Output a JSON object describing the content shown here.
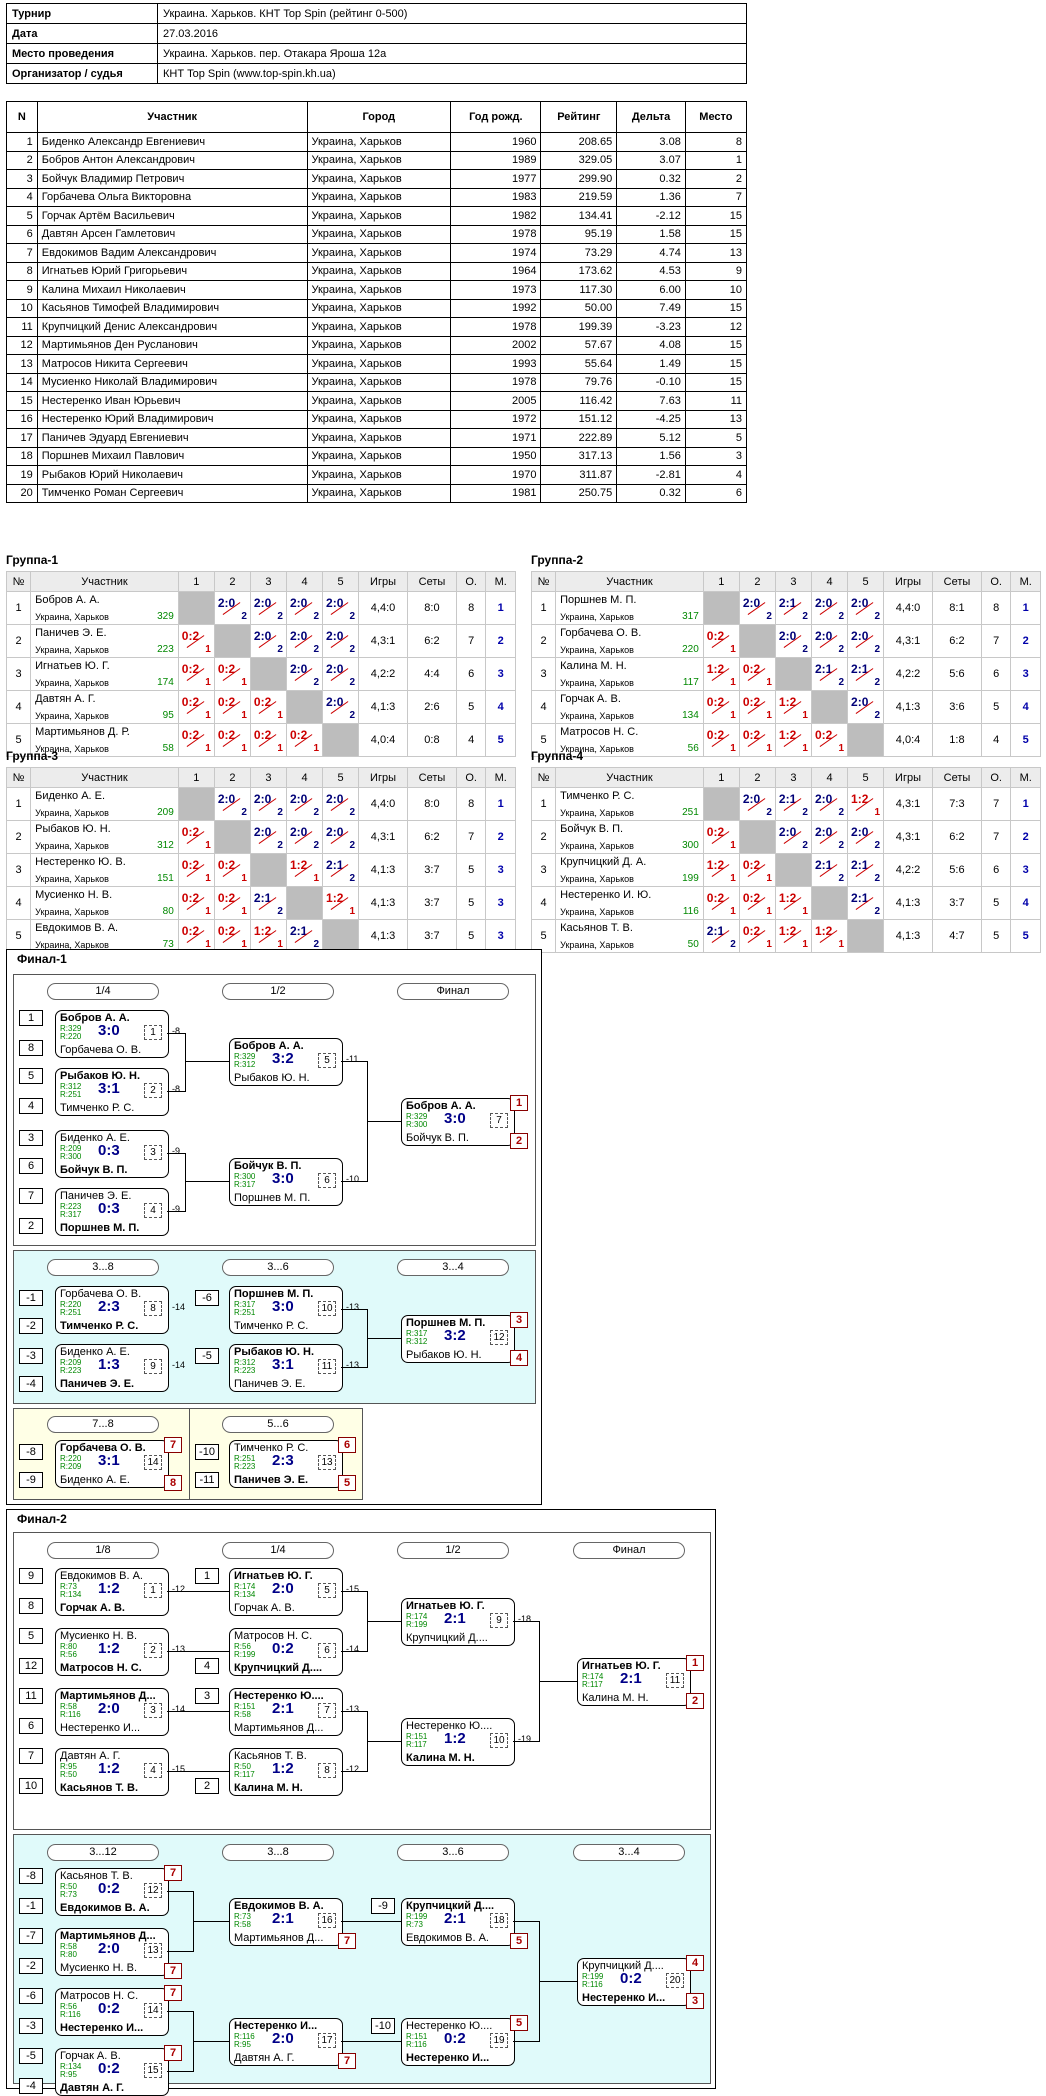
{
  "info": {
    "rows": [
      [
        "Турнир",
        "Украина. Харьков. КНТ Top Spin (рейтинг 0-500)"
      ],
      [
        "Дата",
        "27.03.2016"
      ],
      [
        "Место проведения",
        "Украина. Харьков. пер. Отакара Яроша 12а"
      ],
      [
        "Организатор / судья",
        "КНТ Top Spin (www.top-spin.kh.ua)"
      ]
    ]
  },
  "participants": {
    "headers": [
      "N",
      "Участник",
      "Город",
      "Год рожд.",
      "Рейтинг",
      "Дельта",
      "Место"
    ],
    "rows": [
      [
        "1",
        "Биденко Александр Евгениевич",
        "Украина, Харьков",
        "1960",
        "208.65",
        "3.08",
        "8"
      ],
      [
        "2",
        "Бобров Антон Александрович",
        "Украина, Харьков",
        "1989",
        "329.05",
        "3.07",
        "1"
      ],
      [
        "3",
        "Бойчук Владимир Петрович",
        "Украина, Харьков",
        "1977",
        "299.90",
        "0.32",
        "2"
      ],
      [
        "4",
        "Горбачева Ольга Викторовна",
        "Украина, Харьков",
        "1983",
        "219.59",
        "1.36",
        "7"
      ],
      [
        "5",
        "Горчак Артём Васильевич",
        "Украина, Харьков",
        "1982",
        "134.41",
        "-2.12",
        "15"
      ],
      [
        "6",
        "Давтян Арсен Гамлетович",
        "Украина, Харьков",
        "1978",
        "95.19",
        "1.58",
        "15"
      ],
      [
        "7",
        "Евдокимов Вадим Александрович",
        "Украина, Харьков",
        "1974",
        "73.29",
        "4.74",
        "13"
      ],
      [
        "8",
        "Игнатьев Юрий Григорьевич",
        "Украина, Харьков",
        "1964",
        "173.62",
        "4.53",
        "9"
      ],
      [
        "9",
        "Калина Михаил Николаевич",
        "Украина, Харьков",
        "1973",
        "117.30",
        "6.00",
        "10"
      ],
      [
        "10",
        "Касьянов Тимофей Владимирович",
        "Украина, Харьков",
        "1992",
        "50.00",
        "7.49",
        "15"
      ],
      [
        "11",
        "Крупчицкий Денис Александрович",
        "Украина, Харьков",
        "1978",
        "199.39",
        "-3.23",
        "12"
      ],
      [
        "12",
        "Мартимьянов Ден Русланович",
        "Украина, Харьков",
        "2002",
        "57.67",
        "4.08",
        "15"
      ],
      [
        "13",
        "Матросов Никита Сергеевич",
        "Украина, Харьков",
        "1993",
        "55.64",
        "1.49",
        "15"
      ],
      [
        "14",
        "Мусиенко Николай Владимирович",
        "Украина, Харьков",
        "1978",
        "79.76",
        "-0.10",
        "15"
      ],
      [
        "15",
        "Нестеренко Иван Юрьевич",
        "Украина, Харьков",
        "2005",
        "116.42",
        "7.63",
        "11"
      ],
      [
        "16",
        "Нестеренко Юрий Владимирович",
        "Украина, Харьков",
        "1972",
        "151.12",
        "-4.25",
        "13"
      ],
      [
        "17",
        "Паничев Эдуард Евгениевич",
        "Украина, Харьков",
        "1971",
        "222.89",
        "5.12",
        "5"
      ],
      [
        "18",
        "Поршнев Михаил Павлович",
        "Украина, Харьков",
        "1950",
        "317.13",
        "1.56",
        "3"
      ],
      [
        "19",
        "Рыбаков Юрий Николаевич",
        "Украина, Харьков",
        "1970",
        "311.87",
        "-2.81",
        "4"
      ],
      [
        "20",
        "Тимченко Роман Сергеевич",
        "Украина, Харьков",
        "1981",
        "250.75",
        "0.32",
        "6"
      ]
    ]
  },
  "group_headers": [
    "№",
    "Участник",
    "1",
    "2",
    "3",
    "4",
    "5",
    "Игры",
    "Сеты",
    "О.",
    "М."
  ],
  "groups": [
    {
      "title": "Группа-1",
      "rows": [
        {
          "n": "1",
          "name": "Бобров А. А.",
          "city": "Украина, Харьков",
          "rating": "329",
          "scores": [
            "",
            "2:0",
            "2:0",
            "2:0",
            "2:0"
          ],
          "games": "4,4:0",
          "sets": "8:0",
          "pts": "8",
          "place": "1"
        },
        {
          "n": "2",
          "name": "Паничев Э. Е.",
          "city": "Украина, Харьков",
          "rating": "223",
          "scores": [
            "0:2",
            "",
            "2:0",
            "2:0",
            "2:0"
          ],
          "games": "4,3:1",
          "sets": "6:2",
          "pts": "7",
          "place": "2"
        },
        {
          "n": "3",
          "name": "Игнатьев Ю. Г.",
          "city": "Украина, Харьков",
          "rating": "174",
          "scores": [
            "0:2",
            "0:2",
            "",
            "2:0",
            "2:0"
          ],
          "games": "4,2:2",
          "sets": "4:4",
          "pts": "6",
          "place": "3"
        },
        {
          "n": "4",
          "name": "Давтян А. Г.",
          "city": "Украина, Харьков",
          "rating": "95",
          "scores": [
            "0:2",
            "0:2",
            "0:2",
            "",
            "2:0"
          ],
          "games": "4,1:3",
          "sets": "2:6",
          "pts": "5",
          "place": "4"
        },
        {
          "n": "5",
          "name": "Мартимьянов Д. Р.",
          "city": "Украина, Харьков",
          "rating": "58",
          "scores": [
            "0:2",
            "0:2",
            "0:2",
            "0:2",
            ""
          ],
          "games": "4,0:4",
          "sets": "0:8",
          "pts": "4",
          "place": "5"
        }
      ]
    },
    {
      "title": "Группа-2",
      "rows": [
        {
          "n": "1",
          "name": "Поршнев М. П.",
          "city": "Украина, Харьков",
          "rating": "317",
          "scores": [
            "",
            "2:0",
            "2:1",
            "2:0",
            "2:0"
          ],
          "games": "4,4:0",
          "sets": "8:1",
          "pts": "8",
          "place": "1"
        },
        {
          "n": "2",
          "name": "Горбачева О. В.",
          "city": "Украина, Харьков",
          "rating": "220",
          "scores": [
            "0:2",
            "",
            "2:0",
            "2:0",
            "2:0"
          ],
          "games": "4,3:1",
          "sets": "6:2",
          "pts": "7",
          "place": "2"
        },
        {
          "n": "3",
          "name": "Калина М. Н.",
          "city": "Украина, Харьков",
          "rating": "117",
          "scores": [
            "1:2",
            "0:2",
            "",
            "2:1",
            "2:1"
          ],
          "games": "4,2:2",
          "sets": "5:6",
          "pts": "6",
          "place": "3"
        },
        {
          "n": "4",
          "name": "Горчак А. В.",
          "city": "Украина, Харьков",
          "rating": "134",
          "scores": [
            "0:2",
            "0:2",
            "1:2",
            "",
            "2:0"
          ],
          "games": "4,1:3",
          "sets": "3:6",
          "pts": "5",
          "place": "4"
        },
        {
          "n": "5",
          "name": "Матросов Н. С.",
          "city": "Украина, Харьков",
          "rating": "56",
          "scores": [
            "0:2",
            "0:2",
            "1:2",
            "0:2",
            ""
          ],
          "games": "4,0:4",
          "sets": "1:8",
          "pts": "4",
          "place": "5"
        }
      ]
    },
    {
      "title": "Группа-3",
      "rows": [
        {
          "n": "1",
          "name": "Биденко А. Е.",
          "city": "Украина, Харьков",
          "rating": "209",
          "scores": [
            "",
            "2:0",
            "2:0",
            "2:0",
            "2:0"
          ],
          "games": "4,4:0",
          "sets": "8:0",
          "pts": "8",
          "place": "1"
        },
        {
          "n": "2",
          "name": "Рыбаков Ю. Н.",
          "city": "Украина, Харьков",
          "rating": "312",
          "scores": [
            "0:2",
            "",
            "2:0",
            "2:0",
            "2:0"
          ],
          "games": "4,3:1",
          "sets": "6:2",
          "pts": "7",
          "place": "2"
        },
        {
          "n": "3",
          "name": "Нестеренко Ю. В.",
          "city": "Украина, Харьков",
          "rating": "151",
          "scores": [
            "0:2",
            "0:2",
            "",
            "1:2",
            "2:1"
          ],
          "games": "4,1:3",
          "sets": "3:7",
          "pts": "5",
          "place": "3"
        },
        {
          "n": "4",
          "name": "Мусиенко Н. В.",
          "city": "Украина, Харьков",
          "rating": "80",
          "scores": [
            "0:2",
            "0:2",
            "2:1",
            "",
            "1:2"
          ],
          "games": "4,1:3",
          "sets": "3:7",
          "pts": "5",
          "place": "3"
        },
        {
          "n": "5",
          "name": "Евдокимов В. А.",
          "city": "Украина, Харьков",
          "rating": "73",
          "scores": [
            "0:2",
            "0:2",
            "1:2",
            "2:1",
            ""
          ],
          "games": "4,1:3",
          "sets": "3:7",
          "pts": "5",
          "place": "3"
        }
      ]
    },
    {
      "title": "Группа-4",
      "rows": [
        {
          "n": "1",
          "name": "Тимченко Р. С.",
          "city": "Украина, Харьков",
          "rating": "251",
          "scores": [
            "",
            "2:0",
            "2:1",
            "2:0",
            "1:2"
          ],
          "games": "4,3:1",
          "sets": "7:3",
          "pts": "7",
          "place": "1"
        },
        {
          "n": "2",
          "name": "Бойчук В. П.",
          "city": "Украина, Харьков",
          "rating": "300",
          "scores": [
            "0:2",
            "",
            "2:0",
            "2:0",
            "2:0"
          ],
          "games": "4,3:1",
          "sets": "6:2",
          "pts": "7",
          "place": "2"
        },
        {
          "n": "3",
          "name": "Крупчицкий Д. А.",
          "city": "Украина, Харьков",
          "rating": "199",
          "scores": [
            "1:2",
            "0:2",
            "",
            "2:1",
            "2:1"
          ],
          "games": "4,2:2",
          "sets": "5:6",
          "pts": "6",
          "place": "3"
        },
        {
          "n": "4",
          "name": "Нестеренко И. Ю.",
          "city": "Украина, Харьков",
          "rating": "116",
          "scores": [
            "0:2",
            "0:2",
            "1:2",
            "",
            "2:1"
          ],
          "games": "4,1:3",
          "sets": "3:7",
          "pts": "5",
          "place": "4"
        },
        {
          "n": "5",
          "name": "Касьянов Т. В.",
          "city": "Украина, Харьков",
          "rating": "50",
          "scores": [
            "2:1",
            "0:2",
            "1:2",
            "1:2",
            ""
          ],
          "games": "4,1:3",
          "sets": "4:7",
          "pts": "5",
          "place": "5"
        }
      ]
    }
  ],
  "final1": {
    "title": "Финал-1",
    "rounds": [
      "1/4",
      "1/2",
      "Финал",
      "3...8",
      "3...6",
      "3...4",
      "7...8",
      "5...6"
    ],
    "matches": [
      {
        "p1": "Бобров А. А.",
        "p2": "Горбачева О. В.",
        "r1": "R:329",
        "r2": "R:220",
        "res": "3:0",
        "mn": "1",
        "w": 1,
        "out": "-8"
      },
      {
        "p1": "Рыбаков Ю. Н.",
        "p2": "Тимченко Р. С.",
        "r1": "R:312",
        "r2": "R:251",
        "res": "3:1",
        "mn": "2",
        "w": 1,
        "out": "-8"
      },
      {
        "p1": "Биденко А. Е.",
        "p2": "Бойчук В. П.",
        "r1": "R:209",
        "r2": "R:300",
        "res": "0:3",
        "mn": "3",
        "w": 2,
        "out": "-9"
      },
      {
        "p1": "Паничев Э. Е.",
        "p2": "Поршнев М. П.",
        "r1": "R:223",
        "r2": "R:317",
        "res": "0:3",
        "mn": "4",
        "w": 2,
        "out": "-9"
      },
      {
        "p1": "Бобров А. А.",
        "p2": "Рыбаков Ю. Н.",
        "r1": "R:329",
        "r2": "R:312",
        "res": "3:2",
        "mn": "5",
        "w": 1,
        "out": "-11"
      },
      {
        "p1": "Бойчук В. П.",
        "p2": "Поршнев М. П.",
        "r1": "R:300",
        "r2": "R:317",
        "res": "3:0",
        "mn": "6",
        "w": 1,
        "out": "-10"
      },
      {
        "p1": "Бобров А. А.",
        "p2": "Бойчук В. П.",
        "r1": "R:329",
        "r2": "R:300",
        "res": "3:0",
        "mn": "7",
        "w": 1,
        "pa": [
          "1",
          "2"
        ]
      },
      {
        "p1": "Горбачева О. В.",
        "p2": "Тимченко Р. С.",
        "r1": "R:220",
        "r2": "R:251",
        "res": "2:3",
        "mn": "8",
        "w": 2,
        "out": "-14"
      },
      {
        "p1": "Биденко А. Е.",
        "p2": "Паничев Э. Е.",
        "r1": "R:209",
        "r2": "R:223",
        "res": "1:3",
        "mn": "9",
        "w": 2,
        "out": "-14"
      },
      {
        "p1": "Поршнев М. П.",
        "p2": "Тимченко Р. С.",
        "r1": "R:317",
        "r2": "R:251",
        "res": "3:0",
        "mn": "10",
        "w": 1,
        "out": "-13"
      },
      {
        "p1": "Рыбаков Ю. Н.",
        "p2": "Паничев Э. Е.",
        "r1": "R:312",
        "r2": "R:223",
        "res": "3:1",
        "mn": "11",
        "w": 1,
        "out": "-13"
      },
      {
        "p1": "Поршнев М. П.",
        "p2": "Рыбаков Ю. Н.",
        "r1": "R:317",
        "r2": "R:312",
        "res": "3:2",
        "mn": "12",
        "w": 1,
        "pa": [
          "3",
          "4"
        ]
      },
      {
        "p1": "Горбачева О. В.",
        "p2": "Биденко А. Е.",
        "r1": "R:220",
        "r2": "R:209",
        "res": "3:1",
        "mn": "14",
        "w": 1,
        "pa": [
          "7",
          "8"
        ]
      },
      {
        "p1": "Тимченко Р. С.",
        "p2": "Паничев Э. Е.",
        "r1": "R:251",
        "r2": "R:223",
        "res": "2:3",
        "mn": "13",
        "w": 2,
        "pa": [
          "6",
          "5"
        ]
      }
    ],
    "seeds": [
      "1",
      "8",
      "5",
      "4",
      "3",
      "6",
      "7",
      "2",
      "-1",
      "-2",
      "-3",
      "-4",
      "-6",
      "-5",
      "-8",
      "-9",
      "-10",
      "-11"
    ]
  },
  "final2": {
    "title": "Финал-2",
    "rounds": [
      "1/8",
      "1/4",
      "1/2",
      "Финал",
      "3...12",
      "3...8",
      "3...6",
      "3...4"
    ],
    "matches": [
      {
        "p1": "Евдокимов В. А.",
        "p2": "Горчак А. В.",
        "r1": "R:73",
        "r2": "R:134",
        "res": "1:2",
        "mn": "1",
        "w": 2,
        "out": "-12"
      },
      {
        "p1": "Мусиенко Н. В.",
        "p2": "Матросов Н. С.",
        "r1": "R:80",
        "r2": "R:56",
        "res": "1:2",
        "mn": "2",
        "w": 2,
        "out": "-13"
      },
      {
        "p1": "Мартимьянов Д...",
        "p2": "Нестеренко И...",
        "r1": "R:58",
        "r2": "R:116",
        "res": "2:0",
        "mn": "3",
        "w": 1,
        "out": "-14"
      },
      {
        "p1": "Давтян А. Г.",
        "p2": "Касьянов Т. В.",
        "r1": "R:95",
        "r2": "R:50",
        "res": "1:2",
        "mn": "4",
        "w": 2,
        "out": "-15"
      },
      {
        "p1": "Игнатьев Ю. Г.",
        "p2": "Горчак А. В.",
        "r1": "R:174",
        "r2": "R:134",
        "res": "2:0",
        "mn": "5",
        "w": 1,
        "out": "-15"
      },
      {
        "p1": "Матросов Н. С.",
        "p2": "Крупчицкий Д....",
        "r1": "R:56",
        "r2": "R:199",
        "res": "0:2",
        "mn": "6",
        "w": 2,
        "out": "-14"
      },
      {
        "p1": "Нестеренко Ю....",
        "p2": "Мартимьянов Д...",
        "r1": "R:151",
        "r2": "R:58",
        "res": "2:1",
        "mn": "7",
        "w": 1,
        "out": "-13"
      },
      {
        "p1": "Касьянов Т. В.",
        "p2": "Калина М. Н.",
        "r1": "R:50",
        "r2": "R:117",
        "res": "1:2",
        "mn": "8",
        "w": 2,
        "out": "-12"
      },
      {
        "p1": "Игнатьев Ю. Г.",
        "p2": "Крупчицкий Д....",
        "r1": "R:174",
        "r2": "R:199",
        "res": "2:1",
        "mn": "9",
        "w": 1,
        "out": "-18"
      },
      {
        "p1": "Нестеренко Ю....",
        "p2": "Калина М. Н.",
        "r1": "R:151",
        "r2": "R:117",
        "res": "1:2",
        "mn": "10",
        "w": 2,
        "out": "-19"
      },
      {
        "p1": "Игнатьев Ю. Г.",
        "p2": "Калина М. Н.",
        "r1": "R:174",
        "r2": "R:117",
        "res": "2:1",
        "mn": "11",
        "w": 1,
        "pa": [
          "1",
          "2"
        ]
      },
      {
        "p1": "Касьянов Т. В.",
        "p2": "Евдокимов В. А.",
        "r1": "R:50",
        "r2": "R:73",
        "res": "0:2",
        "mn": "12",
        "w": 2,
        "pa": [
          "7",
          ""
        ]
      },
      {
        "p1": "Мартимьянов Д...",
        "p2": "Мусиенко Н. В.",
        "r1": "R:58",
        "r2": "R:80",
        "res": "2:0",
        "mn": "13",
        "w": 1,
        "pa": [
          "",
          "7"
        ]
      },
      {
        "p1": "Матросов Н. С.",
        "p2": "Нестеренко И...",
        "r1": "R:56",
        "r2": "R:116",
        "res": "0:2",
        "mn": "14",
        "w": 2,
        "pa": [
          "7",
          ""
        ]
      },
      {
        "p1": "Горчак А. В.",
        "p2": "Давтян А. Г.",
        "r1": "R:134",
        "r2": "R:95",
        "res": "0:2",
        "mn": "15",
        "w": 2,
        "pa": [
          "7",
          ""
        ]
      },
      {
        "p1": "Евдокимов В. А.",
        "p2": "Мартимьянов Д...",
        "r1": "R:73",
        "r2": "R:58",
        "res": "2:1",
        "mn": "16",
        "w": 1,
        "pa": [
          "",
          "7"
        ]
      },
      {
        "p1": "Нестеренко И...",
        "p2": "Давтян А. Г.",
        "r1": "R:116",
        "r2": "R:95",
        "res": "2:0",
        "mn": "17",
        "w": 1,
        "pa": [
          "",
          "7"
        ]
      },
      {
        "p1": "Крупчицкий Д....",
        "p2": "Евдокимов В. А.",
        "r1": "R:199",
        "r2": "R:73",
        "res": "2:1",
        "mn": "18",
        "w": 1,
        "pa": [
          "",
          "5"
        ]
      },
      {
        "p1": "Нестеренко Ю....",
        "p2": "Нестеренко И...",
        "r1": "R:151",
        "r2": "R:116",
        "res": "0:2",
        "mn": "19",
        "w": 2,
        "pa": [
          "5",
          ""
        ]
      },
      {
        "p1": "Крупчицкий Д....",
        "p2": "Нестеренко И...",
        "r1": "R:199",
        "r2": "R:116",
        "res": "0:2",
        "mn": "20",
        "w": 2,
        "pa": [
          "4",
          "3"
        ]
      }
    ],
    "seeds": [
      "9",
      "8",
      "5",
      "12",
      "11",
      "6",
      "7",
      "10",
      "1",
      "4",
      "3",
      "2",
      "-8",
      "-1",
      "-7",
      "-2",
      "-6",
      "-3",
      "-5",
      "-4",
      "-9",
      "-10"
    ]
  }
}
